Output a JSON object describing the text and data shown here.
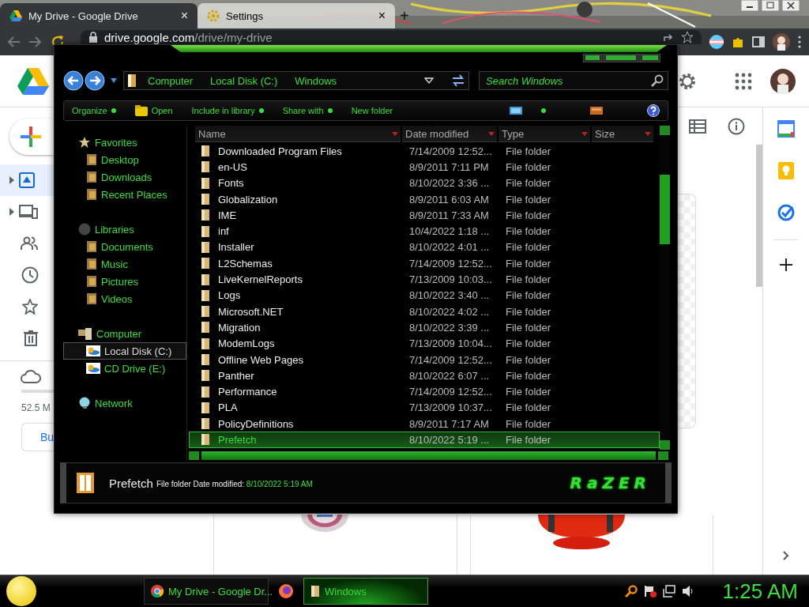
{
  "browser": {
    "tabs": [
      {
        "title": "My Drive - Google Drive",
        "close": "×",
        "selected": true
      },
      {
        "title": "Settings",
        "close": "×",
        "selected": false
      }
    ],
    "new_tab": "+",
    "url": {
      "host": "drive.google.com",
      "path": "/drive/my-drive"
    }
  },
  "drive": {
    "storage": "52.5 M",
    "button": "Bu"
  },
  "explorer": {
    "breadcrumbs": [
      "Computer",
      "Local Disk (C:)",
      "Windows"
    ],
    "search": {
      "placeholder": "Search Windows"
    },
    "commands": [
      {
        "label": "Organize",
        "kind": "menu"
      },
      {
        "label": "Open",
        "kind": "action"
      },
      {
        "label": "Include in library",
        "kind": "menu"
      },
      {
        "label": "Share with",
        "kind": "menu"
      },
      {
        "label": "New folder",
        "kind": "plain"
      }
    ],
    "nav": [
      {
        "label": "Favorites",
        "selected": false,
        "children": [
          {
            "label": "Desktop",
            "selected": false
          },
          {
            "label": "Downloads",
            "selected": false
          },
          {
            "label": "Recent Places",
            "selected": false
          }
        ]
      },
      {
        "label": "Libraries",
        "selected": false,
        "children": [
          {
            "label": "Documents",
            "selected": false
          },
          {
            "label": "Music",
            "selected": false
          },
          {
            "label": "Pictures",
            "selected": false
          },
          {
            "label": "Videos",
            "selected": false
          }
        ]
      },
      {
        "label": "Computer",
        "selected": false,
        "children": [
          {
            "label": "Local Disk (C:)",
            "selected": true
          },
          {
            "label": "CD Drive (E:)",
            "selected": false
          }
        ]
      },
      {
        "label": "Network",
        "selected": false
      }
    ],
    "columns": [
      "Name",
      "Date modified",
      "Type",
      "Size"
    ],
    "rows": [
      {
        "name": "Downloaded Program Files",
        "date": "7/14/2009 12:52...",
        "type": "File folder",
        "selected": false
      },
      {
        "name": "en-US",
        "date": "8/9/2011 7:11 PM",
        "type": "File folder",
        "selected": false
      },
      {
        "name": "Fonts",
        "date": "8/10/2022 3:36 ...",
        "type": "File folder",
        "selected": false
      },
      {
        "name": "Globalization",
        "date": "8/9/2011 6:03 AM",
        "type": "File folder",
        "selected": false
      },
      {
        "name": "IME",
        "date": "8/9/2011 7:33 AM",
        "type": "File folder",
        "selected": false
      },
      {
        "name": "inf",
        "date": "10/4/2022 1:18 ...",
        "type": "File folder",
        "selected": false
      },
      {
        "name": "Installer",
        "date": "8/10/2022 4:01 ...",
        "type": "File folder",
        "selected": false
      },
      {
        "name": "L2Schemas",
        "date": "7/14/2009 12:52...",
        "type": "File folder",
        "selected": false
      },
      {
        "name": "LiveKernelReports",
        "date": "7/13/2009 10:03...",
        "type": "File folder",
        "selected": false
      },
      {
        "name": "Logs",
        "date": "8/10/2022 3:40 ...",
        "type": "File folder",
        "selected": false
      },
      {
        "name": "Microsoft.NET",
        "date": "8/10/2022 4:02 ...",
        "type": "File folder",
        "selected": false
      },
      {
        "name": "Migration",
        "date": "8/10/2022 3:39 ...",
        "type": "File folder",
        "selected": false
      },
      {
        "name": "ModemLogs",
        "date": "7/13/2009 10:04...",
        "type": "File folder",
        "selected": false
      },
      {
        "name": "Offline Web Pages",
        "date": "7/14/2009 12:52...",
        "type": "File folder",
        "selected": false
      },
      {
        "name": "Panther",
        "date": "8/10/2022 6:07 ...",
        "type": "File folder",
        "selected": false
      },
      {
        "name": "Performance",
        "date": "7/14/2009 12:52...",
        "type": "File folder",
        "selected": false
      },
      {
        "name": "PLA",
        "date": "7/13/2009 10:37...",
        "type": "File folder",
        "selected": false
      },
      {
        "name": "PolicyDefinitions",
        "date": "8/9/2011 7:17 AM",
        "type": "File folder",
        "selected": false
      },
      {
        "name": "Prefetch",
        "date": "8/10/2022 5:19 ...",
        "type": "File folder",
        "selected": true
      }
    ],
    "details": {
      "name": "Prefetch",
      "type": "File folder",
      "date_label": "Date modified:",
      "date": "8/10/2022 5:19 AM"
    },
    "logo": "RaZER"
  },
  "taskbar": {
    "tasks": [
      {
        "kind": "button",
        "label": "My Drive - Google Dr...",
        "selected": false
      },
      {
        "kind": "icon",
        "selected": false
      },
      {
        "kind": "button",
        "label": "Windows",
        "selected": true
      }
    ],
    "clock": "1:25 AM"
  }
}
